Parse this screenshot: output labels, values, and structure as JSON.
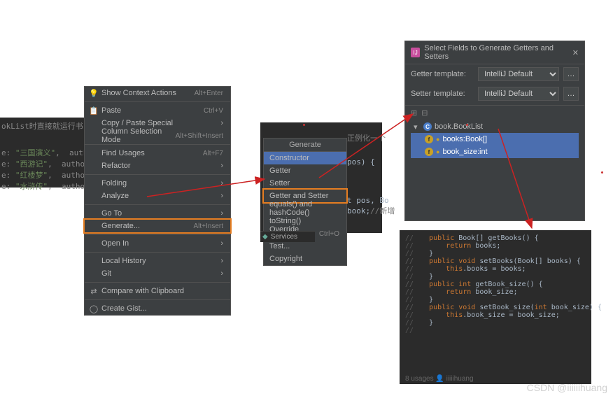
{
  "code_snippet_left": {
    "partial_text": "okList时直接就运行书",
    "lines": [
      {
        "prefix": "e: ",
        "str": "\"三国演义\"",
        "rest": ",  autho"
      },
      {
        "prefix": "e: ",
        "str": "\"西游记\"",
        "rest": ",  autho"
      },
      {
        "prefix": "e: ",
        "str": "\"红楼梦\"",
        "rest": ",  autho"
      },
      {
        "prefix": "e: ",
        "str": "\"水浒传\"",
        "rest": ",  autho"
      }
    ]
  },
  "context_menu": {
    "items": [
      {
        "label": "Show Context Actions",
        "shortcut": "Alt+Enter",
        "icon": "bulb"
      },
      {
        "sep": true
      },
      {
        "label": "Paste",
        "shortcut": "Ctrl+V",
        "icon": "paste"
      },
      {
        "label": "Copy / Paste Special",
        "submenu": true
      },
      {
        "label": "Column Selection Mode",
        "shortcut": "Alt+Shift+Insert"
      },
      {
        "sep": true
      },
      {
        "label": "Find Usages",
        "shortcut": "Alt+F7"
      },
      {
        "label": "Refactor",
        "submenu": true
      },
      {
        "sep": true
      },
      {
        "label": "Folding",
        "submenu": true
      },
      {
        "label": "Analyze",
        "submenu": true
      },
      {
        "sep": true
      },
      {
        "label": "Go To",
        "submenu": true
      },
      {
        "label": "Generate...",
        "shortcut": "Alt+Insert",
        "boxed": true
      },
      {
        "sep": true
      },
      {
        "label": "Open In",
        "submenu": true
      },
      {
        "sep": true
      },
      {
        "label": "Local History",
        "submenu": true
      },
      {
        "label": "Git",
        "submenu": true
      },
      {
        "sep": true
      },
      {
        "label": "Compare with Clipboard",
        "icon": "compare"
      },
      {
        "sep": true
      },
      {
        "label": "Create Gist...",
        "icon": "github"
      }
    ]
  },
  "generate_menu": {
    "title": "Generate",
    "items": [
      {
        "label": "Constructor",
        "highlighted": true
      },
      {
        "label": "Getter"
      },
      {
        "label": "Setter"
      },
      {
        "label": "Getter and Setter",
        "boxed": true
      },
      {
        "label": "equals() and hashCode()"
      },
      {
        "label": "toString()"
      },
      {
        "label": "Override Methods...",
        "shortcut": "Ctrl+O"
      },
      {
        "label": "Test..."
      },
      {
        "label": "Copyright"
      }
    ],
    "footer_icon": "services-icon",
    "footer_text": "Services"
  },
  "code_snippet_mid": {
    "lines": [
      "正例化一个",
      "pos) {",
      "",
      "t pos, Bo",
      "book;//新增"
    ]
  },
  "dialog": {
    "title": "Select Fields to Generate Getters and Setters",
    "getter_label": "Getter template:",
    "setter_label": "Setter template:",
    "template_value": "IntelliJ Default",
    "tree": {
      "root": "book.BookList",
      "fields": [
        {
          "name": "books:Book[]"
        },
        {
          "name": "book_size:int"
        }
      ]
    }
  },
  "generated_code": {
    "lines": [
      "    public Book[] getBooks() {",
      "        return books;",
      "    }",
      "",
      "    public void setBooks(Book[] books) {",
      "        this.books = books;",
      "    }",
      "",
      "    public int getBook_size() {",
      "        return book_size;",
      "    }",
      "",
      "    public void setBook_size(int book_size) {",
      "        this.book_size = book_size;",
      "    }",
      ""
    ],
    "footer": "8 usages   👤 iiiiihuang"
  },
  "watermark": "CSDN @iiiiiihuang"
}
